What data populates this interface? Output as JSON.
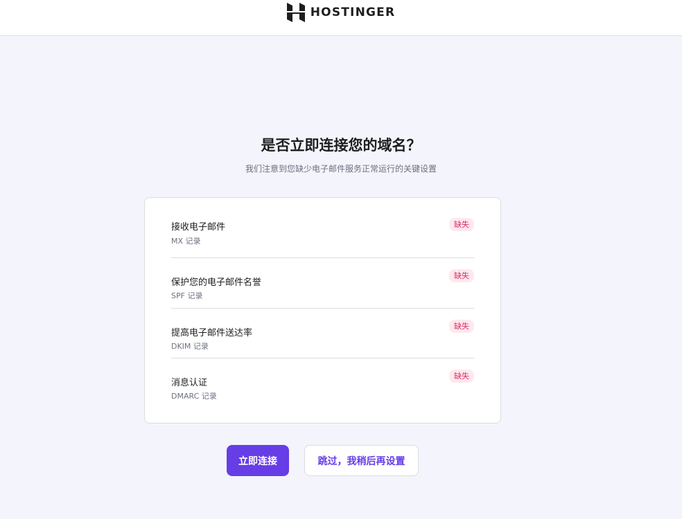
{
  "header": {
    "brand": "HOSTINGER"
  },
  "dialog": {
    "title": "是否立即连接您的域名？",
    "subtitle": "我们注意到您缺少电子邮件服务正常运行的关键设置"
  },
  "records": [
    {
      "title": "接收电子邮件",
      "record": "MX 记录",
      "status": "缺失"
    },
    {
      "title": "保护您的电子邮件名誉",
      "record": "SPF 记录",
      "status": "缺失"
    },
    {
      "title": "提高电子邮件送达率",
      "record": "DKIM 记录",
      "status": "缺失"
    },
    {
      "title": "消息认证",
      "record": "DMARC 记录",
      "status": "缺失"
    }
  ],
  "actions": {
    "connect_label": "立即连接",
    "skip_label": "跳过，我稍后再设置"
  },
  "colors": {
    "accent": "#673de6",
    "badge_bg": "#ffe8ef",
    "badge_text": "#d63163",
    "page_bg": "#f4f4fc"
  }
}
